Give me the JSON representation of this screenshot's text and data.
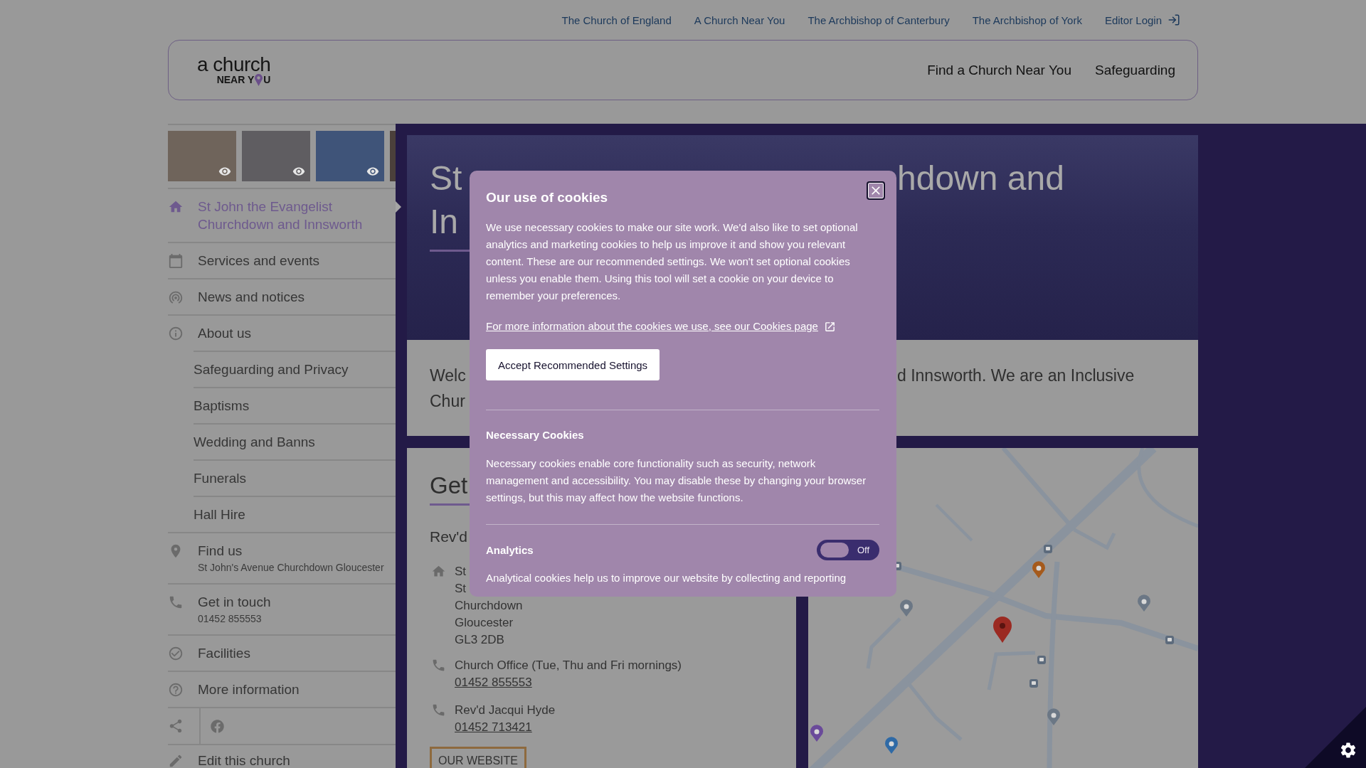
{
  "top_links": [
    {
      "label": "The Church of England",
      "kind": "text"
    },
    {
      "label": "A Church Near You",
      "kind": "text"
    },
    {
      "label": "The Archbishop of Canterbury",
      "kind": "text"
    },
    {
      "label": "The Archbishop of York",
      "kind": "text"
    },
    {
      "label": "Editor Login",
      "kind": "login"
    }
  ],
  "header": {
    "logo": {
      "top": "a church",
      "bottom_before": "NEAR Y",
      "bottom_after": "U"
    },
    "nav": [
      {
        "label": "Find a Church Near You"
      },
      {
        "label": "Safeguarding"
      }
    ]
  },
  "sidebar": {
    "thumbnails": [
      {
        "kind": "photo"
      },
      {
        "kind": "photo"
      },
      {
        "kind": "photo"
      },
      {
        "kind": "cut"
      }
    ],
    "items": [
      {
        "label": "St John the Evangelist Churchdown and Innsworth",
        "selected": true
      },
      {
        "label": "Services and events",
        "selected": false
      },
      {
        "label": "News and notices",
        "selected": false
      },
      {
        "label": "About us",
        "selected": false,
        "children": [
          {
            "label": "Safeguarding and Privacy",
            "selected": false
          },
          {
            "label": "Baptisms",
            "selected": false
          },
          {
            "label": "Wedding and Banns",
            "selected": false
          },
          {
            "label": "Funerals",
            "selected": false
          },
          {
            "label": "Hall Hire",
            "selected": false
          }
        ]
      },
      {
        "label": "Find us",
        "detail": "St John's Avenue Churchdown Gloucester",
        "selected": false
      },
      {
        "label": "Get in touch",
        "detail": "01452 855553",
        "selected": false
      },
      {
        "label": "Facilities",
        "selected": false
      },
      {
        "label": "More information",
        "selected": false
      }
    ],
    "edit_link": {
      "label": "Edit this church"
    }
  },
  "hero": {
    "title_lines": [
      {
        "left": "St",
        "right": "hdown and"
      },
      {
        "left": "In"
      }
    ]
  },
  "welcome": {
    "lines": [
      {
        "left": "Welc",
        "right": "d Innsworth. We are an Inclusive"
      },
      {
        "left": "Chur"
      }
    ]
  },
  "contact": {
    "heading": "Get",
    "name": "Rev'd",
    "address": [
      "St",
      "St",
      "Churchdown",
      "Gloucester",
      "GL3 2DB"
    ],
    "phones": [
      {
        "label": "Church Office (Tue, Thu and Fri mornings)",
        "number": "01452 855553"
      },
      {
        "label": "Rev'd Jacqui Hyde",
        "number": "01452 713421"
      }
    ],
    "website_button": "OUR WEBSITE"
  },
  "cookie_dialog": {
    "title": "Our use of cookies",
    "intro": "We use necessary cookies to make our site work. We'd also like to set optional analytics and marketing cookies to help us improve it and show you relevant content. These are our recommended settings. We won't set optional cookies unless you enable them. Using this tool will set a cookie on your device to remember your preferences.",
    "link": "For more information about the cookies we use, see our Cookies page",
    "accept_button": "Accept Recommended Settings",
    "sections": [
      {
        "title": "Necessary Cookies",
        "text": "Necessary cookies enable core functionality such as security, network management and accessibility. You may disable these by changing your browser settings, but this may affect how the website functions."
      },
      {
        "title": "Analytics",
        "toggle": {
          "on": false,
          "label": "Off"
        },
        "text": "Analytical cookies help us to improve our website by collecting and reporting"
      }
    ]
  }
}
